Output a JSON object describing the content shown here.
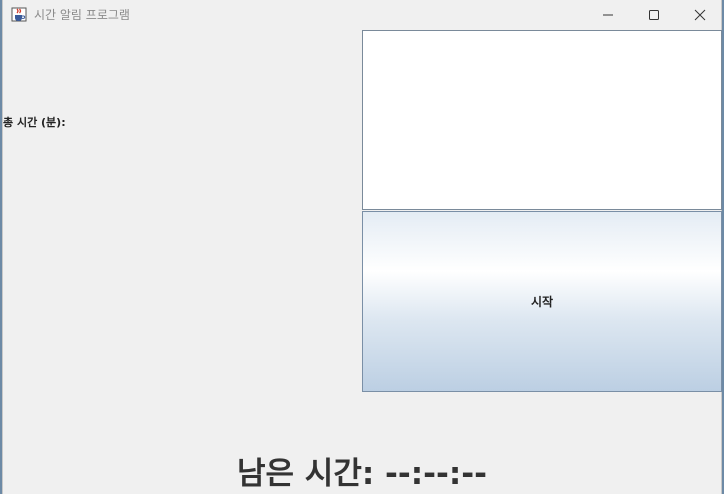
{
  "window": {
    "title": "시간 알림 프로그램",
    "icon": "java-cup-icon"
  },
  "controls": {
    "minimize": "minimize-icon",
    "maximize": "maximize-icon",
    "close": "close-icon"
  },
  "form": {
    "total_time_label": "총 시간 (분):",
    "input_value": "",
    "start_label": "시작"
  },
  "status": {
    "remaining_text": "남은 시간: --:--:--"
  },
  "colors": {
    "window_bg": "#f0f0f0",
    "button_gradient_bottom": "#bccfe3"
  }
}
